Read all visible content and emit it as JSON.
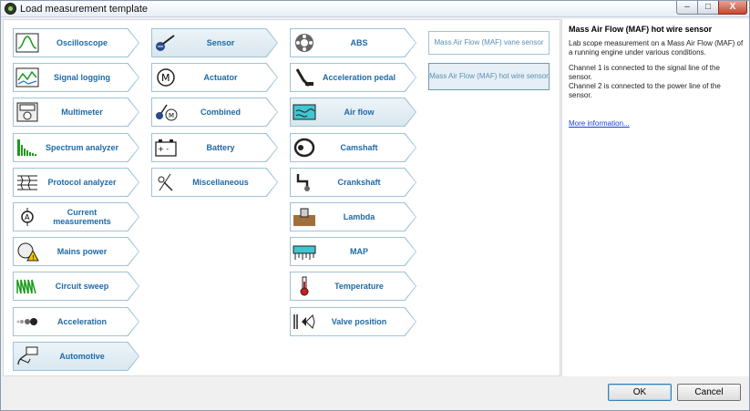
{
  "window": {
    "title": "Load measurement template",
    "min": "–",
    "max": "□",
    "close": "X"
  },
  "columns": [
    {
      "tiles": [
        {
          "label": "Oscilloscope",
          "icon": "oscilloscope-icon",
          "selected": false
        },
        {
          "label": "Signal logging",
          "icon": "signal-logging-icon",
          "selected": false
        },
        {
          "label": "Multimeter",
          "icon": "multimeter-icon",
          "selected": false
        },
        {
          "label": "Spectrum analyzer",
          "icon": "spectrum-analyzer-icon",
          "selected": false
        },
        {
          "label": "Protocol analyzer",
          "icon": "protocol-analyzer-icon",
          "selected": false
        },
        {
          "label": "Current measurements",
          "icon": "current-clamp-icon",
          "selected": false
        },
        {
          "label": "Mains power",
          "icon": "mains-power-icon",
          "selected": false
        },
        {
          "label": "Circuit sweep",
          "icon": "circuit-sweep-icon",
          "selected": false
        },
        {
          "label": "Acceleration",
          "icon": "acceleration-icon",
          "selected": false
        },
        {
          "label": "Automotive",
          "icon": "automotive-icon",
          "selected": true
        }
      ]
    },
    {
      "tiles": [
        {
          "label": "Sensor",
          "icon": "sensor-icon",
          "selected": true
        },
        {
          "label": "Actuator",
          "icon": "motor-icon",
          "selected": false
        },
        {
          "label": "Combined",
          "icon": "combined-icon",
          "selected": false
        },
        {
          "label": "Battery",
          "icon": "battery-icon",
          "selected": false
        },
        {
          "label": "Miscellaneous",
          "icon": "miscellaneous-icon",
          "selected": false
        }
      ]
    },
    {
      "tiles": [
        {
          "label": "ABS",
          "icon": "abs-wheel-icon",
          "selected": false
        },
        {
          "label": "Acceleration pedal",
          "icon": "pedal-icon",
          "selected": false
        },
        {
          "label": "Air flow",
          "icon": "air-flow-icon",
          "selected": true
        },
        {
          "label": "Camshaft",
          "icon": "camshaft-icon",
          "selected": false
        },
        {
          "label": "Crankshaft",
          "icon": "crankshaft-icon",
          "selected": false
        },
        {
          "label": "Lambda",
          "icon": "lambda-icon",
          "selected": false
        },
        {
          "label": "MAP",
          "icon": "map-sensor-icon",
          "selected": false
        },
        {
          "label": "Temperature",
          "icon": "thermometer-icon",
          "selected": false
        },
        {
          "label": "Valve position",
          "icon": "valve-icon",
          "selected": false
        }
      ]
    }
  ],
  "variants": [
    {
      "label": "Mass Air Flow (MAF) vane sensor",
      "selected": false
    },
    {
      "label": "Mass Air Flow (MAF) hot wire sensor",
      "selected": true
    }
  ],
  "info": {
    "title": "Mass Air Flow (MAF) hot wire sensor",
    "description": "Lab scope measurement on a Mass Air Flow (MAF) of a running engine under various conditions.",
    "channel1": "Channel 1 is connected to the signal line of the sensor.",
    "channel2": "Channel 2 is connected to the power line of the sensor.",
    "link": "More information..."
  },
  "buttons": {
    "ok": "OK",
    "cancel": "Cancel"
  }
}
